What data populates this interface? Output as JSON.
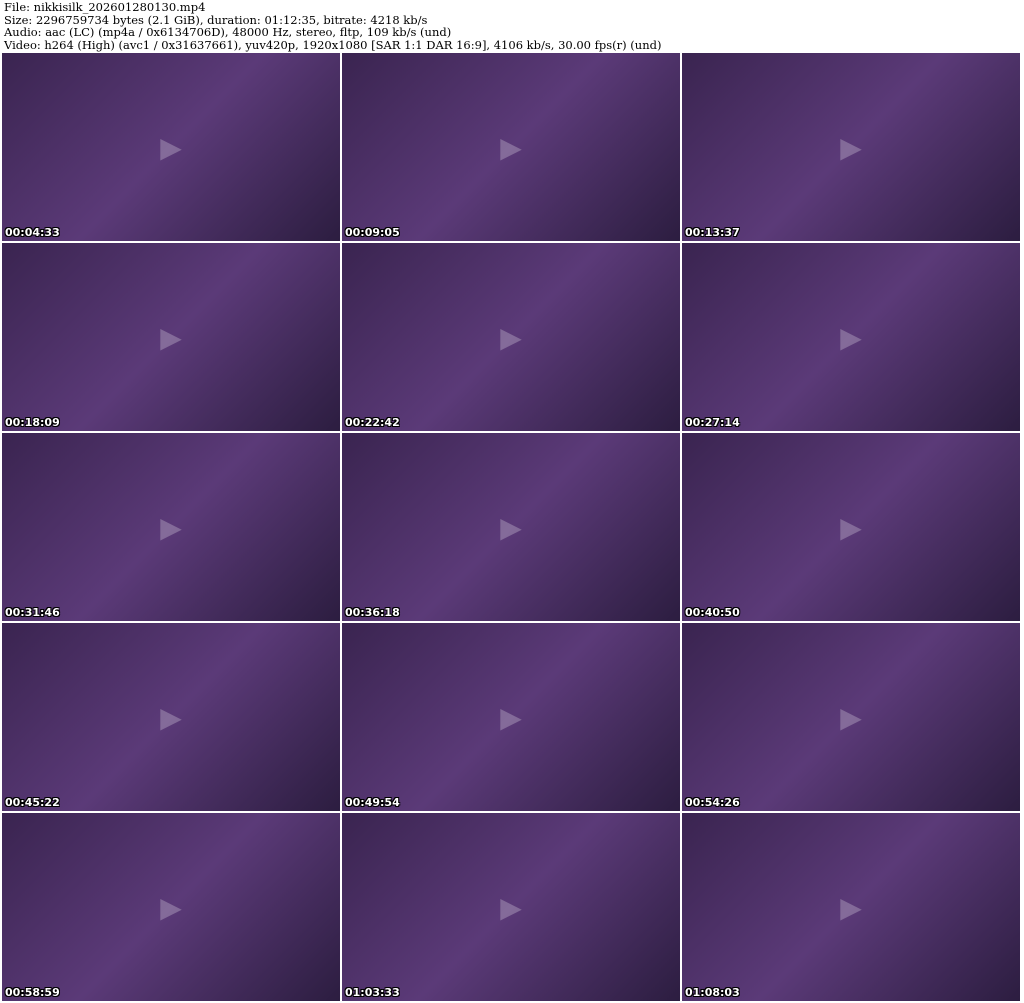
{
  "header": {
    "file": "File: nikkisilk_202601280130.mp4",
    "size": "Size: 2296759734 bytes (2.1 GiB), duration: 01:12:35, bitrate: 4218 kb/s",
    "audio": "Audio: aac (LC) (mp4a / 0x6134706D), 48000 Hz, stereo, fltp, 109 kb/s (und)",
    "video": "Video: h264 (High) (avc1 / 0x31637661), yuv420p, 1920x1080 [SAR 1:1 DAR 16:9], 4106 kb/s, 30.00 fps(r) (und)"
  },
  "thumbnails": [
    {
      "timestamp": "00:04:33"
    },
    {
      "timestamp": "00:09:05"
    },
    {
      "timestamp": "00:13:37"
    },
    {
      "timestamp": "00:18:09"
    },
    {
      "timestamp": "00:22:42"
    },
    {
      "timestamp": "00:27:14"
    },
    {
      "timestamp": "00:31:46"
    },
    {
      "timestamp": "00:36:18"
    },
    {
      "timestamp": "00:40:50"
    },
    {
      "timestamp": "00:45:22"
    },
    {
      "timestamp": "00:49:54"
    },
    {
      "timestamp": "00:54:26"
    },
    {
      "timestamp": "00:58:59"
    },
    {
      "timestamp": "01:03:33"
    },
    {
      "timestamp": "01:08:03"
    }
  ]
}
